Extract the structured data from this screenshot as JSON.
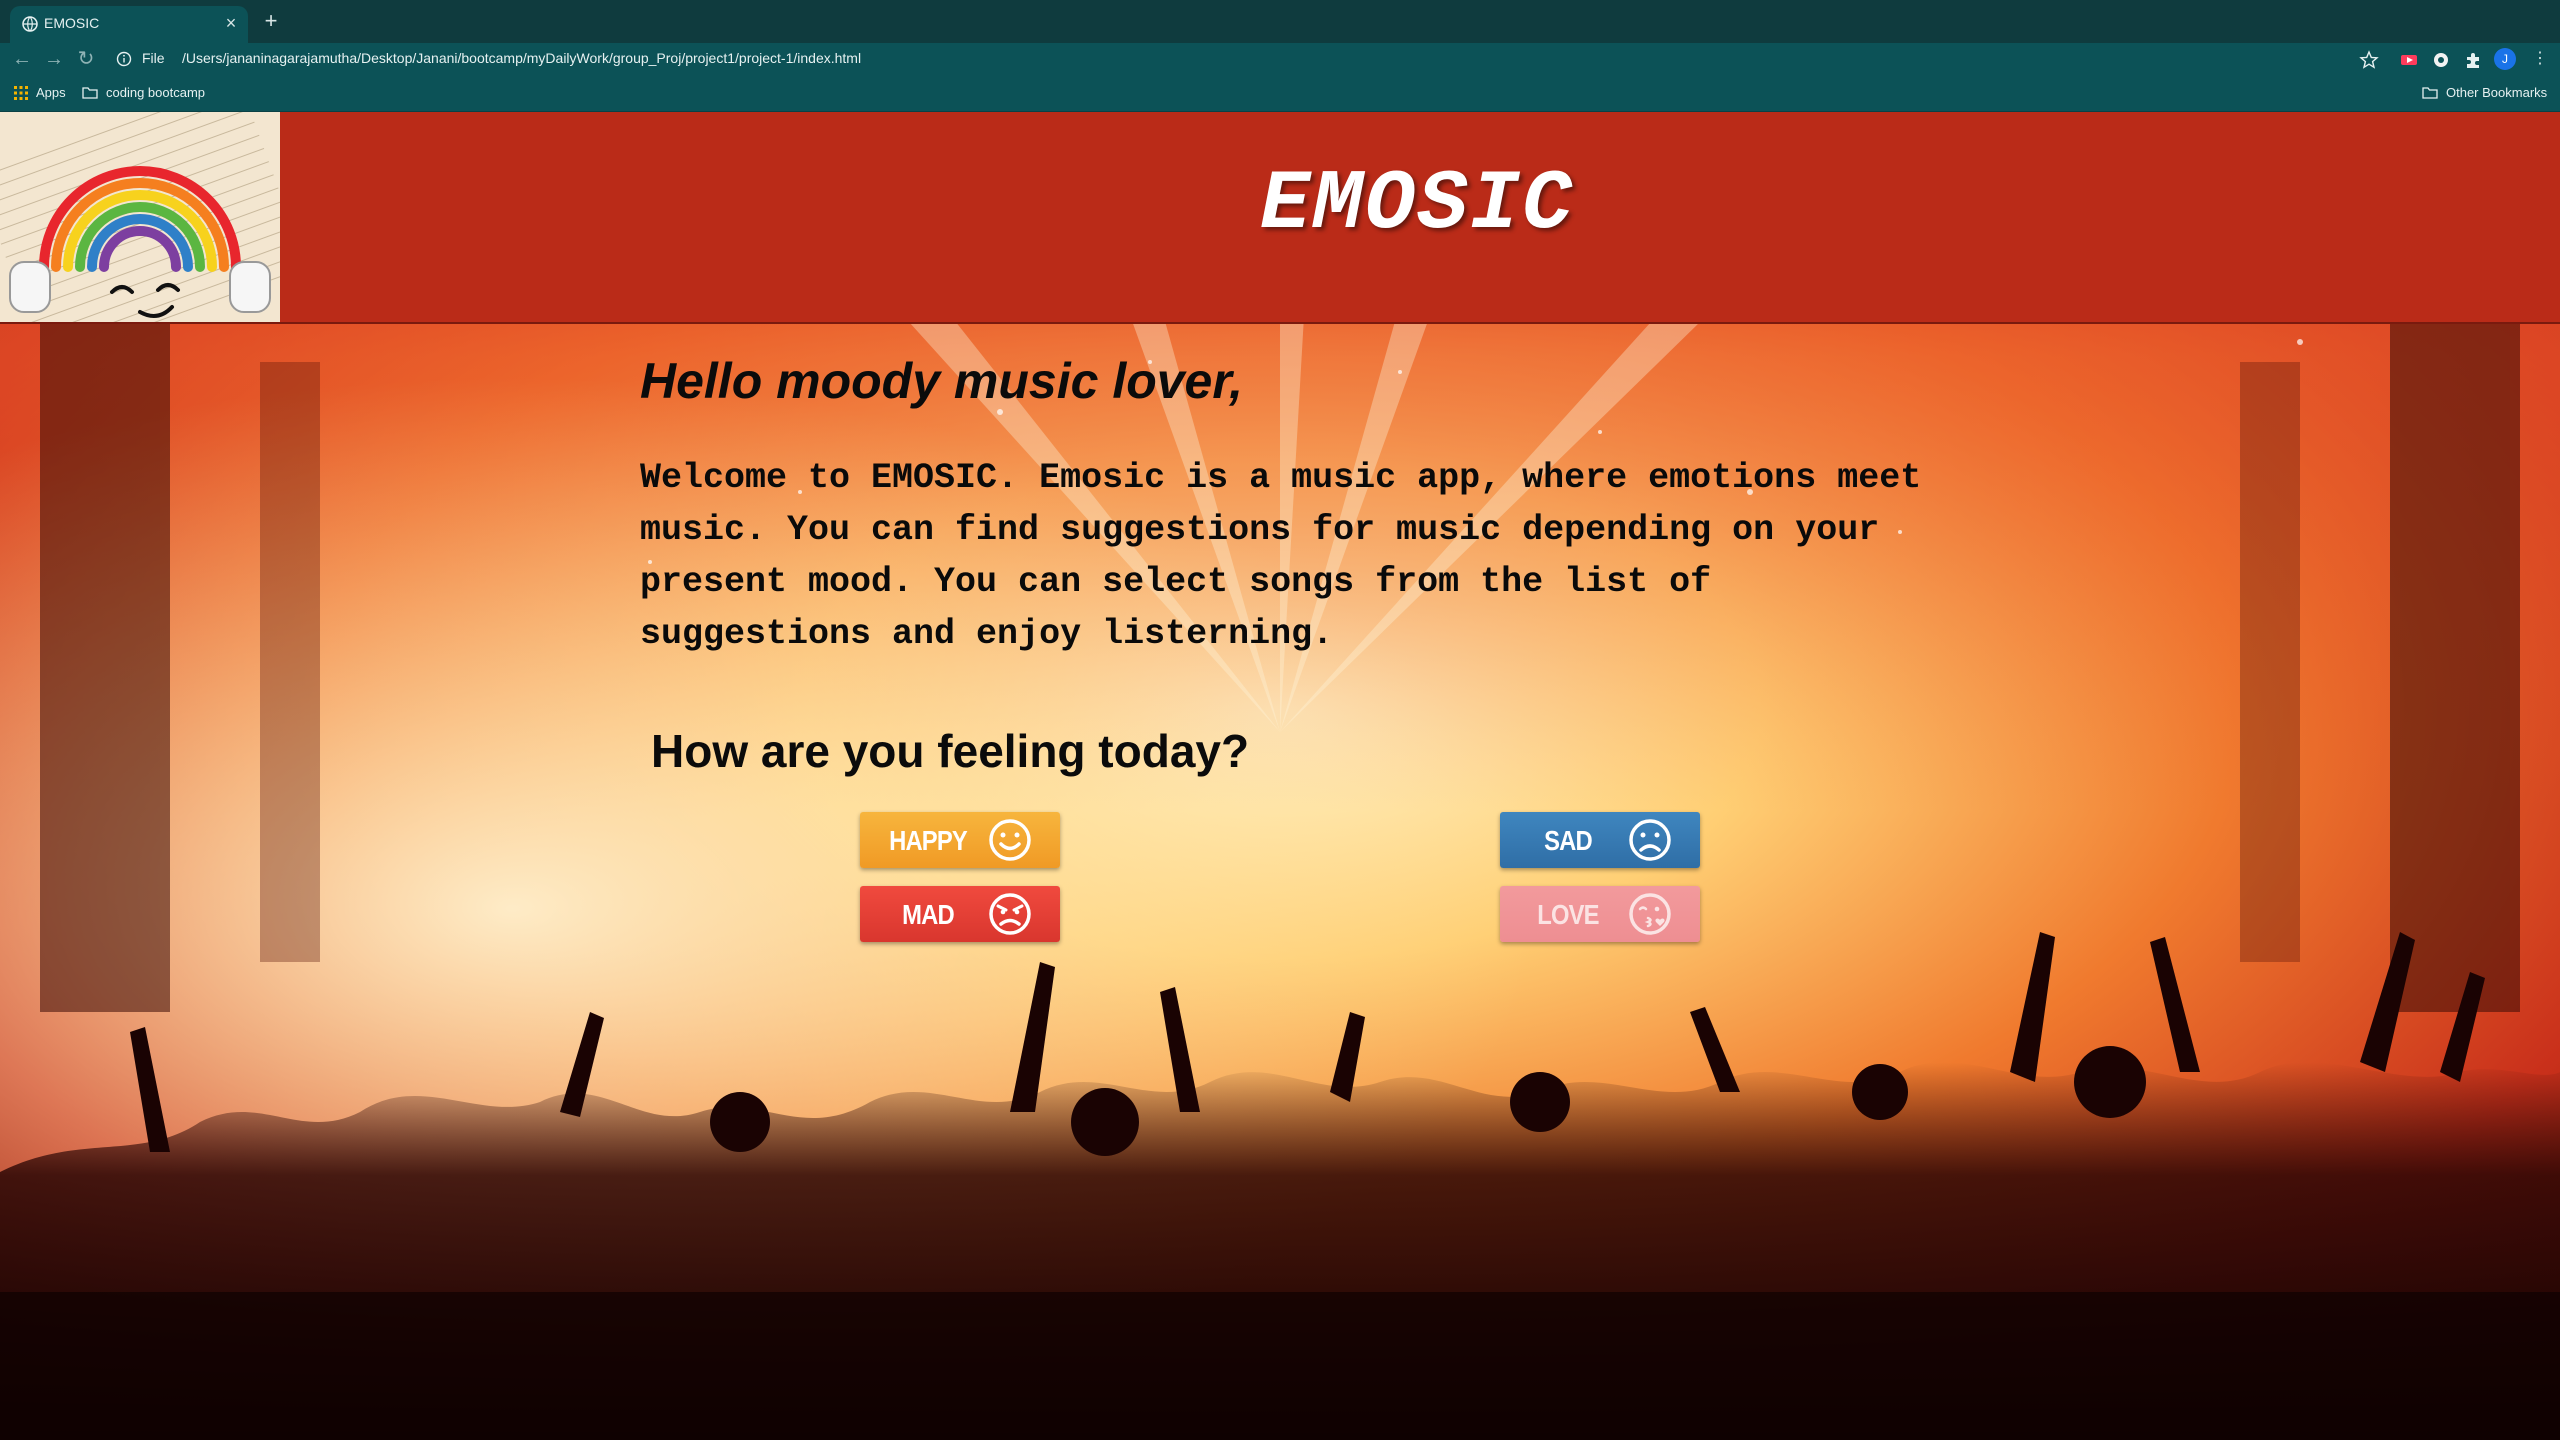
{
  "browser": {
    "tab_title": "EMOSIC",
    "tab_close": "×",
    "new_tab": "+",
    "file_label": "File",
    "url": "/Users/jananinagarajamutha/Desktop/Janani/bootcamp/myDailyWork/group_Proj/project1/project-1/index.html",
    "profile_initial": "J",
    "menu": "⋮",
    "bookmarks": {
      "apps_label": "Apps",
      "folder_label": "coding bootcamp",
      "other_label": "Other Bookmarks"
    }
  },
  "header": {
    "title": "EMOSIC",
    "logo_icon": "rainbow-headphones-smiley"
  },
  "content": {
    "greeting": "Hello moody music lover,",
    "intro": "Welcome to EMOSIC. Emosic is a music app, where emotions meet music. You can find suggestions for music depending on your present mood. You can select songs from the list of suggestions and enjoy listerning.",
    "question": "How are you feeling today?"
  },
  "moods": {
    "happy": {
      "label": "HAPPY",
      "icon": "smile-face-icon",
      "color": "#f4a832"
    },
    "sad": {
      "label": "SAD",
      "icon": "sad-face-icon",
      "color": "#3a7db5"
    },
    "mad": {
      "label": "MAD",
      "icon": "angry-face-icon",
      "color": "#e8413a"
    },
    "love": {
      "label": "LOVE",
      "icon": "kiss-face-icon",
      "color": "#f09498"
    }
  },
  "colors": {
    "header_red": "#ba2b18",
    "browser_chrome": "#0c5257"
  }
}
